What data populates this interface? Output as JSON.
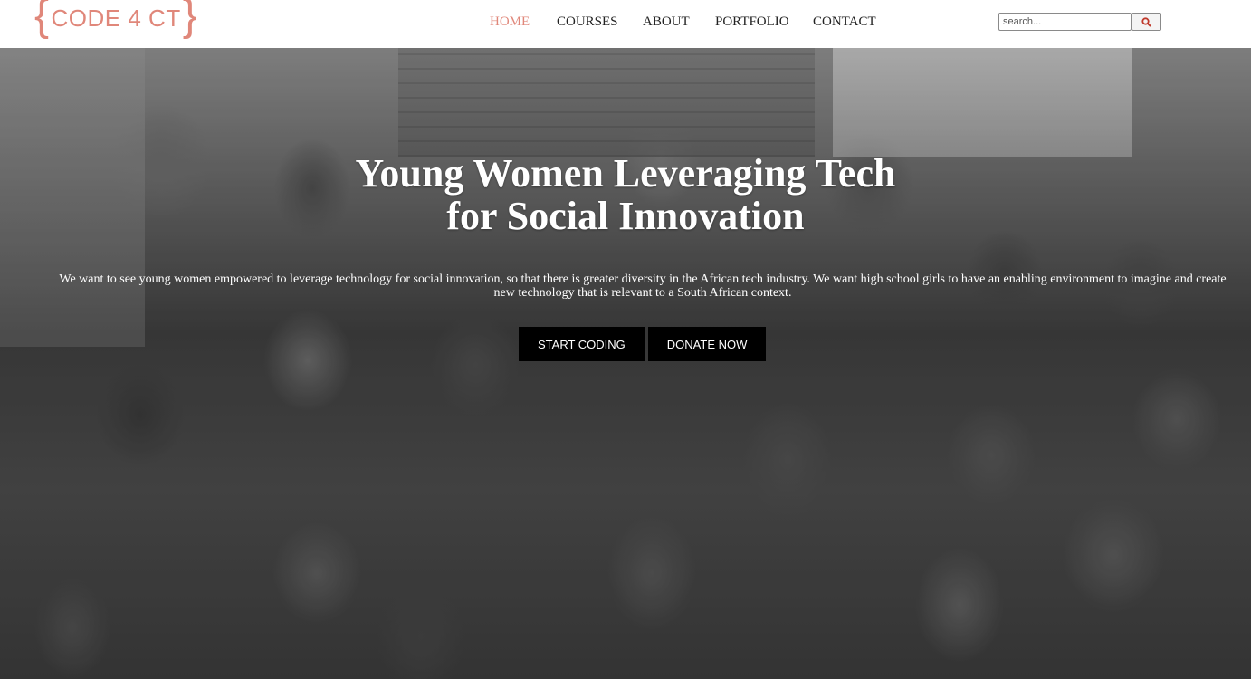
{
  "logo": {
    "open_brace": "{",
    "text": "CODE 4 CT",
    "close_brace": "}"
  },
  "nav": {
    "items": [
      {
        "label": "HOME",
        "active": true
      },
      {
        "label": "COURSES",
        "active": false
      },
      {
        "label": "ABOUT",
        "active": false
      },
      {
        "label": "PORTFOLIO",
        "active": false
      },
      {
        "label": "CONTACT",
        "active": false
      }
    ]
  },
  "search": {
    "placeholder": "search...",
    "button_icon": "search-icon"
  },
  "hero": {
    "title_line1": "Young Women Leveraging Tech",
    "title_line2": "for Social Innovation",
    "text": "We want to see young women empowered to leverage technology for social innovation, so that there is greater diversity in the African tech industry. We want high school girls to have an enabling environment to imagine and create new technology that is relevant to a South African context.",
    "primary_button": "START CODING",
    "secondary_button": "DONATE NOW"
  },
  "colors": {
    "accent": "#e0877a",
    "button_bg": "#000000",
    "nav_text": "#222222"
  }
}
